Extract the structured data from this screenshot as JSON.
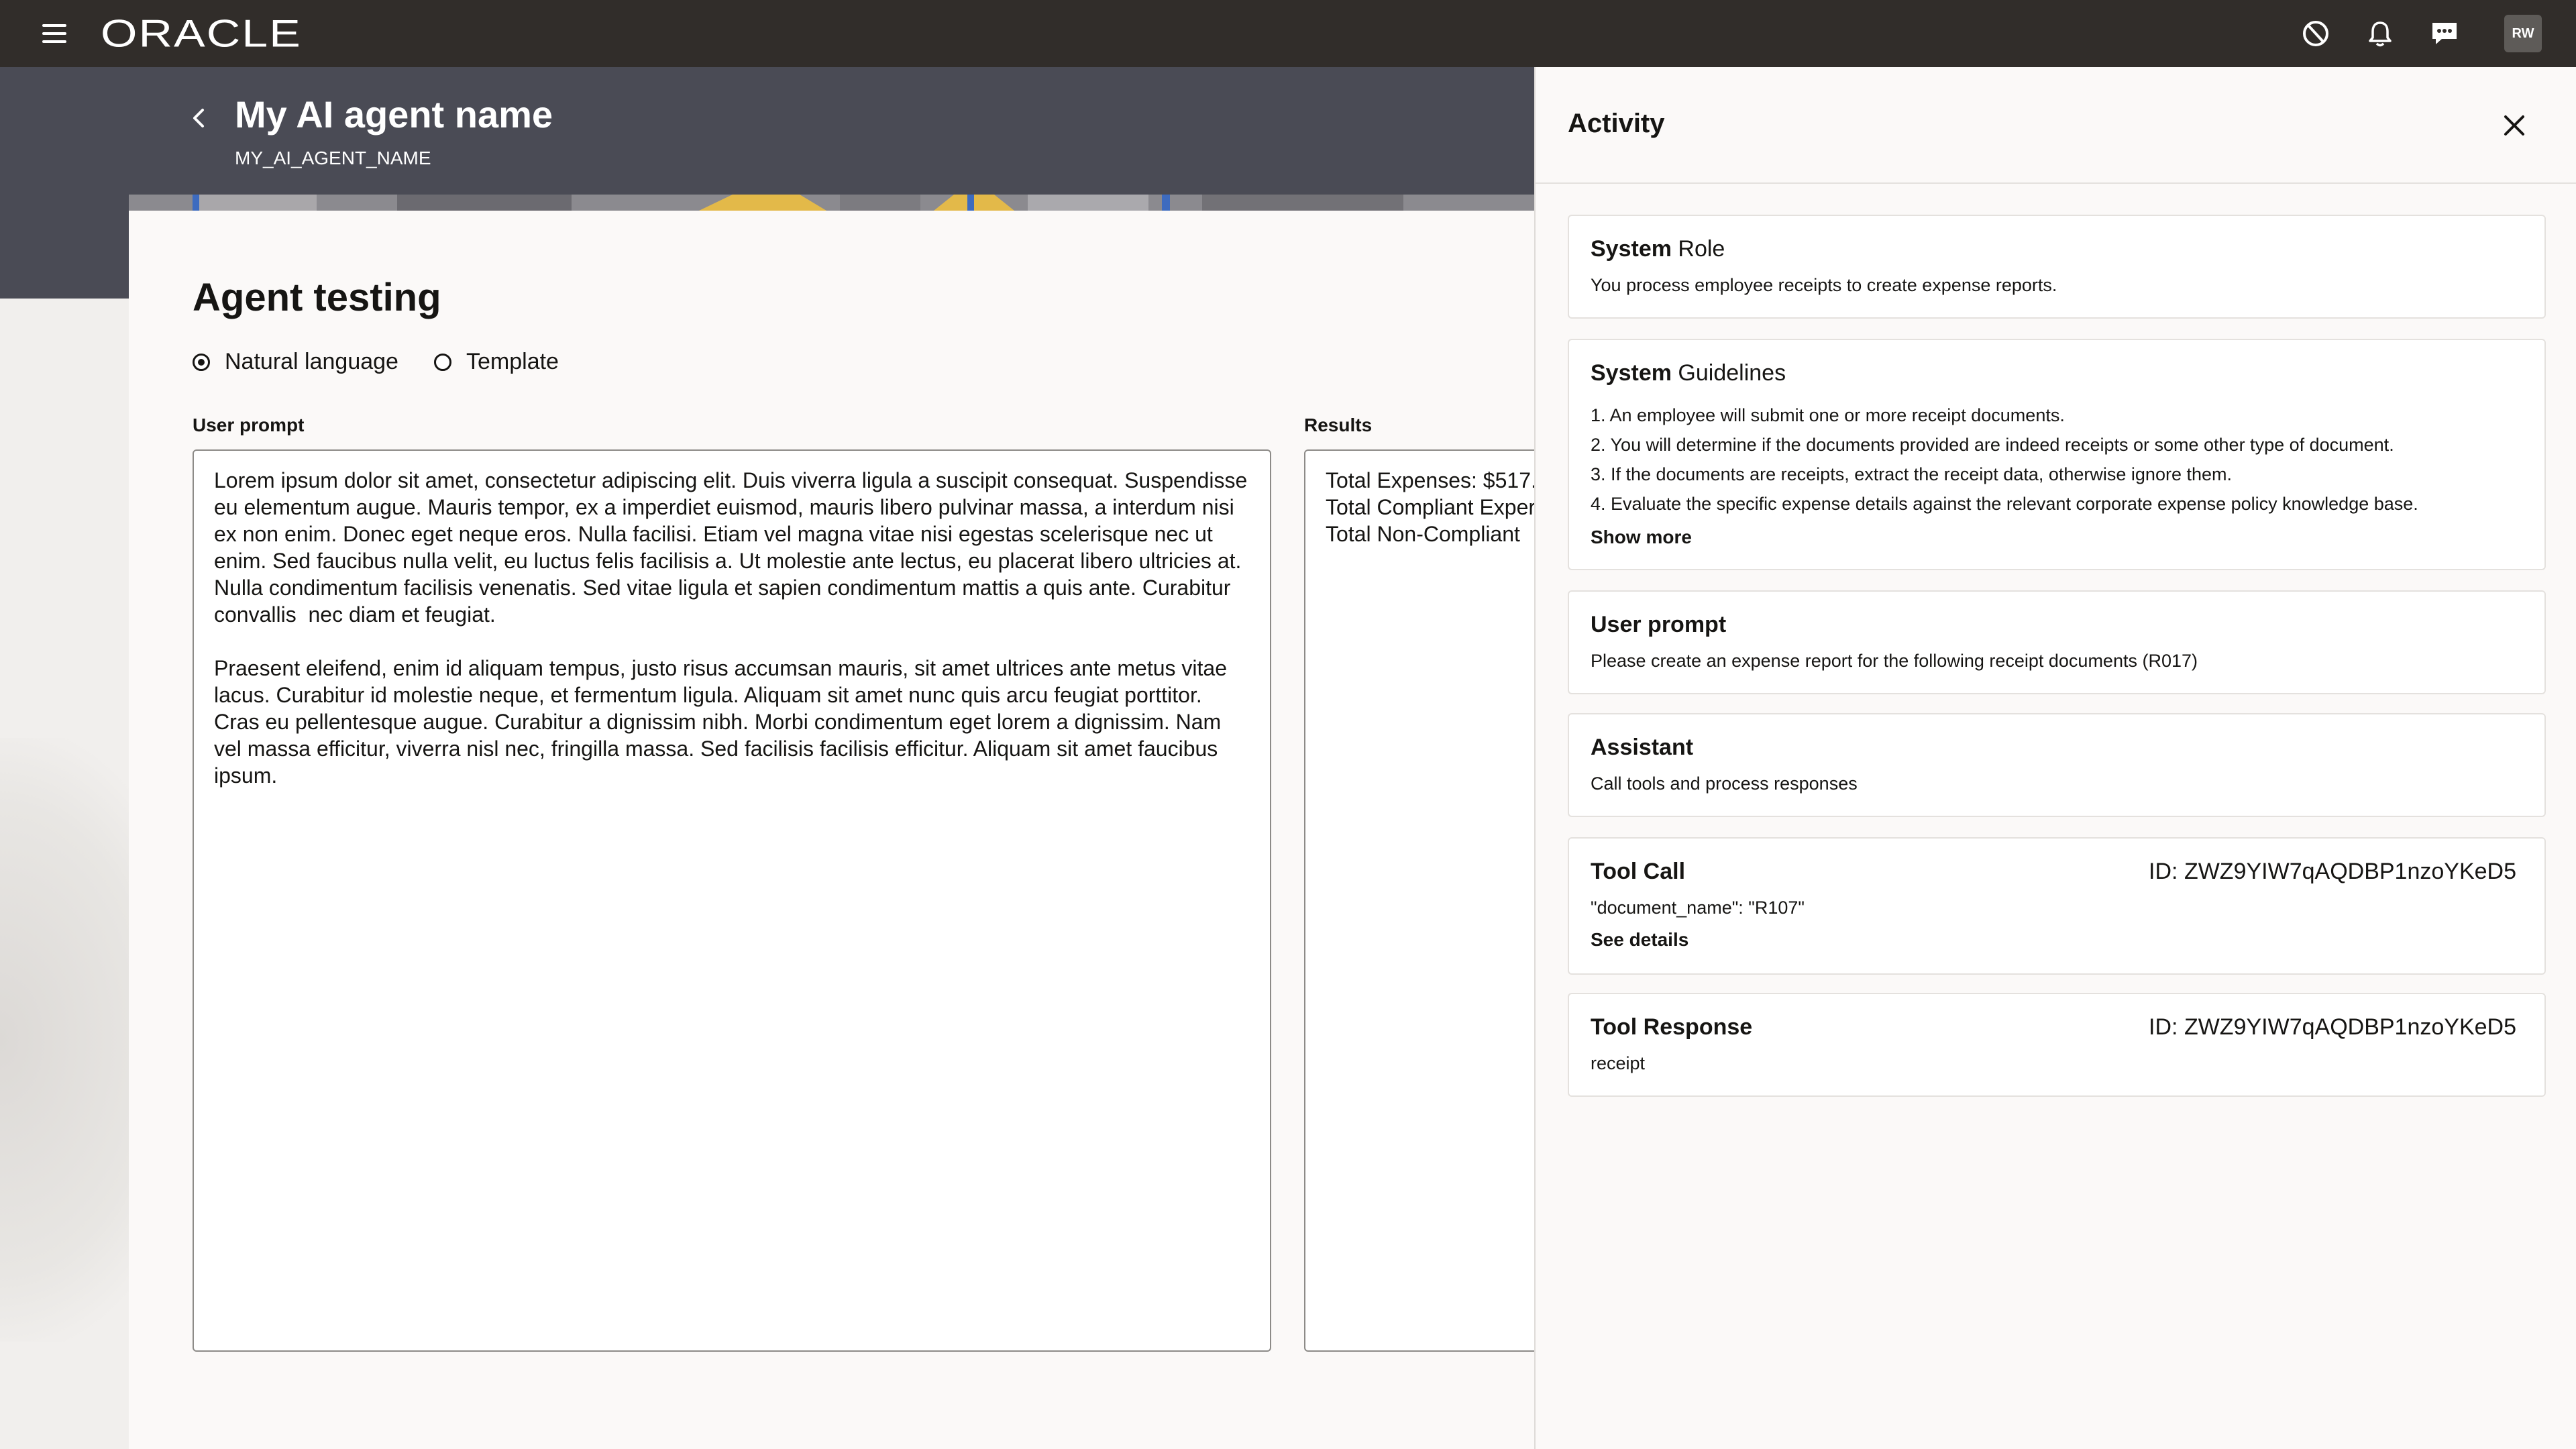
{
  "topbar": {
    "brand": "ORACLE",
    "avatar_initials": "RW",
    "icons": [
      "menu-icon",
      "no-entry-icon",
      "bell-icon",
      "chat-icon"
    ]
  },
  "header": {
    "title": "My AI agent name",
    "subtitle": "MY_AI_AGENT_NAME"
  },
  "main": {
    "section_title": "Agent testing",
    "modes": [
      {
        "label": "Natural language",
        "selected": true
      },
      {
        "label": "Template",
        "selected": false
      }
    ],
    "user_prompt_label": "User prompt",
    "user_prompt_value": "Lorem ipsum dolor sit amet, consectetur adipiscing elit. Duis viverra ligula a suscipit consequat. Suspendisse eu elementum augue. Mauris tempor, ex a imperdiet euismod, mauris libero pulvinar massa, a interdum nisi ex non enim. Donec eget neque eros. Nulla facilisi. Etiam vel magna vitae nisi egestas scelerisque nec ut enim. Sed faucibus nulla velit, eu luctus felis facilisis a. Ut molestie ante lectus, eu placerat libero ultricies at. Nulla condimentum facilisis venenatis. Sed vitae ligula et sapien condimentum mattis a quis ante. Curabitur convallis  nec diam et feugiat.\n\nPraesent eleifend, enim id aliquam tempus, justo risus accumsan mauris, sit amet ultrices ante metus vitae lacus. Curabitur id molestie neque, et fermentum ligula. Aliquam sit amet nunc quis arcu feugiat porttitor. Cras eu pellentesque augue. Curabitur a dignissim nibh. Morbi condimentum eget lorem a dignissim. Nam vel massa efficitur, viverra nisl nec, fringilla massa. Sed facilisis facilisis efficitur. Aliquam sit amet faucibus ipsum.",
    "results_label": "Results",
    "results_value": "Total Expenses: $517.\nTotal Compliant Exper\nTotal Non-Compliant"
  },
  "activity": {
    "title": "Activity",
    "system_role": {
      "title_bold": "System",
      "title_rest": " Role",
      "text": "You process employee receipts to create expense reports."
    },
    "system_guidelines": {
      "title_bold": "System",
      "title_rest": " Guidelines",
      "items": [
        "1. An employee will submit one or more receipt documents.",
        "2. You will determine if the documents provided are indeed receipts or some other type of document.",
        "3. If the documents are receipts, extract the receipt data, otherwise ignore them.",
        "4. Evaluate the specific expense details against the relevant corporate expense policy knowledge base."
      ],
      "show_more": "Show more"
    },
    "user_prompt": {
      "title": "User prompt",
      "text": "Please create an expense report for the following receipt documents (R017)"
    },
    "assistant": {
      "title": "Assistant",
      "text": "Call tools and process responses"
    },
    "tool_call": {
      "title": "Tool Call",
      "id": "ID: ZWZ9YIW7qAQDBP1nzoYKeD5",
      "text": "\"document_name\": \"R107\"",
      "link": "See details"
    },
    "tool_response": {
      "title": "Tool Response",
      "id": "ID: ZWZ9YIW7qAQDBP1nzoYKeD5",
      "text": "receipt"
    }
  }
}
